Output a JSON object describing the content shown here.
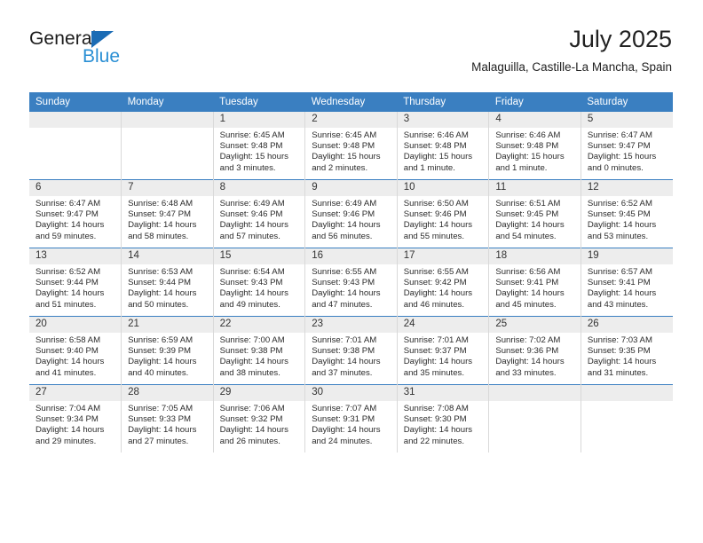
{
  "brand": {
    "name_part1": "General",
    "name_part2": "Blue"
  },
  "header": {
    "title": "July 2025",
    "subtitle": "Malaguilla, Castille-La Mancha, Spain"
  },
  "colors": {
    "header_blue": "#3a7fc1",
    "daynum_gray": "#ededed",
    "brand_blue": "#2a8fd4",
    "triangle_blue": "#1b6cb5"
  },
  "weekdays": [
    "Sunday",
    "Monday",
    "Tuesday",
    "Wednesday",
    "Thursday",
    "Friday",
    "Saturday"
  ],
  "weeks": [
    [
      {
        "day": ""
      },
      {
        "day": ""
      },
      {
        "day": "1",
        "sunrise": "Sunrise: 6:45 AM",
        "sunset": "Sunset: 9:48 PM",
        "daylight_line1": "Daylight: 15 hours",
        "daylight_line2": "and 3 minutes."
      },
      {
        "day": "2",
        "sunrise": "Sunrise: 6:45 AM",
        "sunset": "Sunset: 9:48 PM",
        "daylight_line1": "Daylight: 15 hours",
        "daylight_line2": "and 2 minutes."
      },
      {
        "day": "3",
        "sunrise": "Sunrise: 6:46 AM",
        "sunset": "Sunset: 9:48 PM",
        "daylight_line1": "Daylight: 15 hours",
        "daylight_line2": "and 1 minute."
      },
      {
        "day": "4",
        "sunrise": "Sunrise: 6:46 AM",
        "sunset": "Sunset: 9:48 PM",
        "daylight_line1": "Daylight: 15 hours",
        "daylight_line2": "and 1 minute."
      },
      {
        "day": "5",
        "sunrise": "Sunrise: 6:47 AM",
        "sunset": "Sunset: 9:47 PM",
        "daylight_line1": "Daylight: 15 hours",
        "daylight_line2": "and 0 minutes."
      }
    ],
    [
      {
        "day": "6",
        "sunrise": "Sunrise: 6:47 AM",
        "sunset": "Sunset: 9:47 PM",
        "daylight_line1": "Daylight: 14 hours",
        "daylight_line2": "and 59 minutes."
      },
      {
        "day": "7",
        "sunrise": "Sunrise: 6:48 AM",
        "sunset": "Sunset: 9:47 PM",
        "daylight_line1": "Daylight: 14 hours",
        "daylight_line2": "and 58 minutes."
      },
      {
        "day": "8",
        "sunrise": "Sunrise: 6:49 AM",
        "sunset": "Sunset: 9:46 PM",
        "daylight_line1": "Daylight: 14 hours",
        "daylight_line2": "and 57 minutes."
      },
      {
        "day": "9",
        "sunrise": "Sunrise: 6:49 AM",
        "sunset": "Sunset: 9:46 PM",
        "daylight_line1": "Daylight: 14 hours",
        "daylight_line2": "and 56 minutes."
      },
      {
        "day": "10",
        "sunrise": "Sunrise: 6:50 AM",
        "sunset": "Sunset: 9:46 PM",
        "daylight_line1": "Daylight: 14 hours",
        "daylight_line2": "and 55 minutes."
      },
      {
        "day": "11",
        "sunrise": "Sunrise: 6:51 AM",
        "sunset": "Sunset: 9:45 PM",
        "daylight_line1": "Daylight: 14 hours",
        "daylight_line2": "and 54 minutes."
      },
      {
        "day": "12",
        "sunrise": "Sunrise: 6:52 AM",
        "sunset": "Sunset: 9:45 PM",
        "daylight_line1": "Daylight: 14 hours",
        "daylight_line2": "and 53 minutes."
      }
    ],
    [
      {
        "day": "13",
        "sunrise": "Sunrise: 6:52 AM",
        "sunset": "Sunset: 9:44 PM",
        "daylight_line1": "Daylight: 14 hours",
        "daylight_line2": "and 51 minutes."
      },
      {
        "day": "14",
        "sunrise": "Sunrise: 6:53 AM",
        "sunset": "Sunset: 9:44 PM",
        "daylight_line1": "Daylight: 14 hours",
        "daylight_line2": "and 50 minutes."
      },
      {
        "day": "15",
        "sunrise": "Sunrise: 6:54 AM",
        "sunset": "Sunset: 9:43 PM",
        "daylight_line1": "Daylight: 14 hours",
        "daylight_line2": "and 49 minutes."
      },
      {
        "day": "16",
        "sunrise": "Sunrise: 6:55 AM",
        "sunset": "Sunset: 9:43 PM",
        "daylight_line1": "Daylight: 14 hours",
        "daylight_line2": "and 47 minutes."
      },
      {
        "day": "17",
        "sunrise": "Sunrise: 6:55 AM",
        "sunset": "Sunset: 9:42 PM",
        "daylight_line1": "Daylight: 14 hours",
        "daylight_line2": "and 46 minutes."
      },
      {
        "day": "18",
        "sunrise": "Sunrise: 6:56 AM",
        "sunset": "Sunset: 9:41 PM",
        "daylight_line1": "Daylight: 14 hours",
        "daylight_line2": "and 45 minutes."
      },
      {
        "day": "19",
        "sunrise": "Sunrise: 6:57 AM",
        "sunset": "Sunset: 9:41 PM",
        "daylight_line1": "Daylight: 14 hours",
        "daylight_line2": "and 43 minutes."
      }
    ],
    [
      {
        "day": "20",
        "sunrise": "Sunrise: 6:58 AM",
        "sunset": "Sunset: 9:40 PM",
        "daylight_line1": "Daylight: 14 hours",
        "daylight_line2": "and 41 minutes."
      },
      {
        "day": "21",
        "sunrise": "Sunrise: 6:59 AM",
        "sunset": "Sunset: 9:39 PM",
        "daylight_line1": "Daylight: 14 hours",
        "daylight_line2": "and 40 minutes."
      },
      {
        "day": "22",
        "sunrise": "Sunrise: 7:00 AM",
        "sunset": "Sunset: 9:38 PM",
        "daylight_line1": "Daylight: 14 hours",
        "daylight_line2": "and 38 minutes."
      },
      {
        "day": "23",
        "sunrise": "Sunrise: 7:01 AM",
        "sunset": "Sunset: 9:38 PM",
        "daylight_line1": "Daylight: 14 hours",
        "daylight_line2": "and 37 minutes."
      },
      {
        "day": "24",
        "sunrise": "Sunrise: 7:01 AM",
        "sunset": "Sunset: 9:37 PM",
        "daylight_line1": "Daylight: 14 hours",
        "daylight_line2": "and 35 minutes."
      },
      {
        "day": "25",
        "sunrise": "Sunrise: 7:02 AM",
        "sunset": "Sunset: 9:36 PM",
        "daylight_line1": "Daylight: 14 hours",
        "daylight_line2": "and 33 minutes."
      },
      {
        "day": "26",
        "sunrise": "Sunrise: 7:03 AM",
        "sunset": "Sunset: 9:35 PM",
        "daylight_line1": "Daylight: 14 hours",
        "daylight_line2": "and 31 minutes."
      }
    ],
    [
      {
        "day": "27",
        "sunrise": "Sunrise: 7:04 AM",
        "sunset": "Sunset: 9:34 PM",
        "daylight_line1": "Daylight: 14 hours",
        "daylight_line2": "and 29 minutes."
      },
      {
        "day": "28",
        "sunrise": "Sunrise: 7:05 AM",
        "sunset": "Sunset: 9:33 PM",
        "daylight_line1": "Daylight: 14 hours",
        "daylight_line2": "and 27 minutes."
      },
      {
        "day": "29",
        "sunrise": "Sunrise: 7:06 AM",
        "sunset": "Sunset: 9:32 PM",
        "daylight_line1": "Daylight: 14 hours",
        "daylight_line2": "and 26 minutes."
      },
      {
        "day": "30",
        "sunrise": "Sunrise: 7:07 AM",
        "sunset": "Sunset: 9:31 PM",
        "daylight_line1": "Daylight: 14 hours",
        "daylight_line2": "and 24 minutes."
      },
      {
        "day": "31",
        "sunrise": "Sunrise: 7:08 AM",
        "sunset": "Sunset: 9:30 PM",
        "daylight_line1": "Daylight: 14 hours",
        "daylight_line2": "and 22 minutes."
      },
      {
        "day": ""
      },
      {
        "day": ""
      }
    ]
  ]
}
